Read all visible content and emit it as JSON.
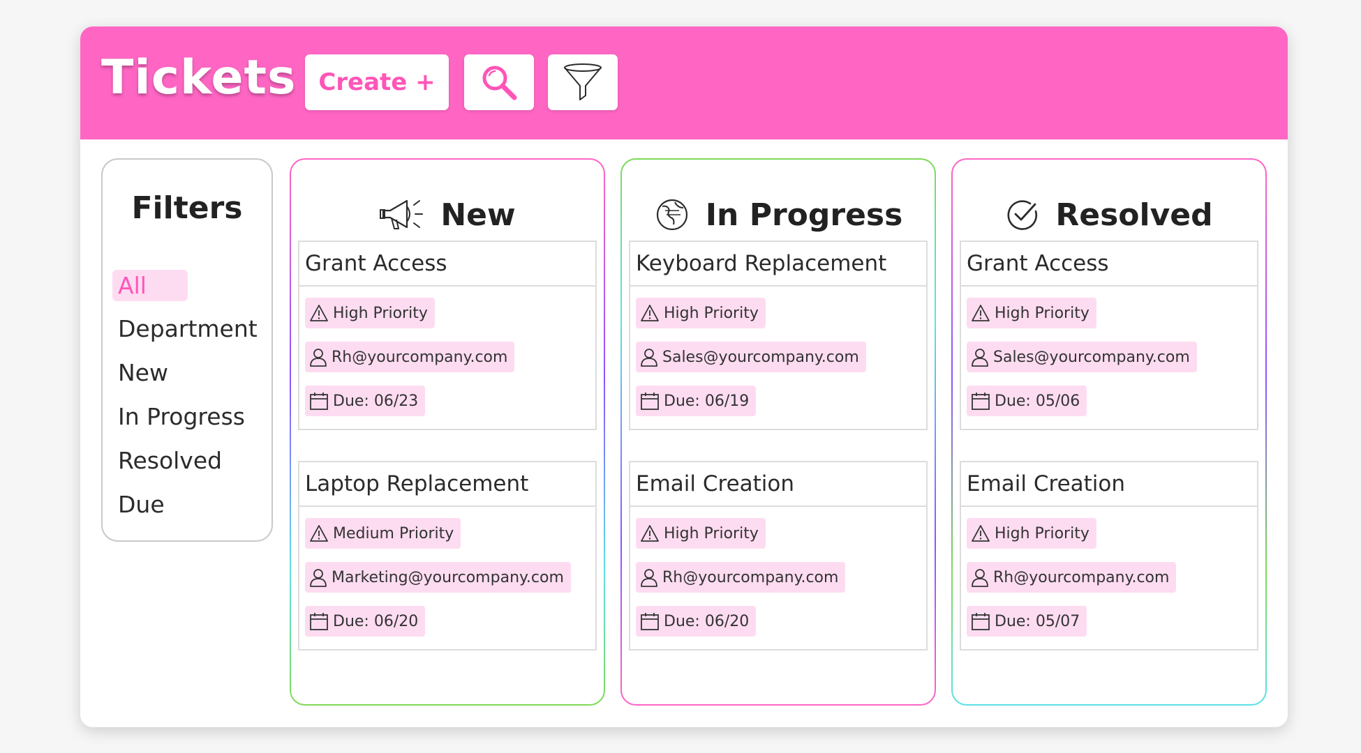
{
  "header": {
    "title": "Tickets",
    "create_label": "Create +",
    "search_icon": "search-icon",
    "filter_icon": "funnel-icon",
    "bg_color": "#ff66c4",
    "accent_color": "#ff55b8"
  },
  "filters": {
    "title": "Filters",
    "items": [
      {
        "label": "All",
        "active": true
      },
      {
        "label": "Department",
        "active": false
      },
      {
        "label": "New",
        "active": false
      },
      {
        "label": "In Progress",
        "active": false
      },
      {
        "label": "Resolved",
        "active": false
      },
      {
        "label": "Due",
        "active": false
      }
    ]
  },
  "columns": [
    {
      "title": "New",
      "icon": "megaphone-icon",
      "cards": [
        {
          "title": "Grant Access",
          "priority": "High Priority",
          "email": "Rh@yourcompany.com",
          "due": "Due: 06/23"
        },
        {
          "title": "Laptop Replacement",
          "priority": "Medium Priority",
          "email": "Marketing@yourcompany.com",
          "due": "Due: 06/20"
        }
      ]
    },
    {
      "title": "In Progress",
      "icon": "globe-icon",
      "cards": [
        {
          "title": "Keyboard Replacement",
          "priority": "High Priority",
          "email": "Sales@yourcompany.com",
          "due": "Due: 06/19"
        },
        {
          "title": "Email Creation",
          "priority": "High Priority",
          "email": "Rh@yourcompany.com",
          "due": "Due: 06/20"
        }
      ]
    },
    {
      "title": "Resolved",
      "icon": "check-circle-icon",
      "cards": [
        {
          "title": "Grant Access",
          "priority": "High Priority",
          "email": "Sales@yourcompany.com",
          "due": "Due: 05/06"
        },
        {
          "title": "Email Creation",
          "priority": "High Priority",
          "email": "Rh@yourcompany.com",
          "due": "Due: 05/07"
        }
      ]
    }
  ],
  "colors": {
    "chip_bg": "#fddcf1",
    "gradient_pink": "#ff66c4",
    "gradient_purple": "#8c52ff",
    "gradient_cyan": "#5ce1e6",
    "gradient_green": "#7ed957"
  }
}
